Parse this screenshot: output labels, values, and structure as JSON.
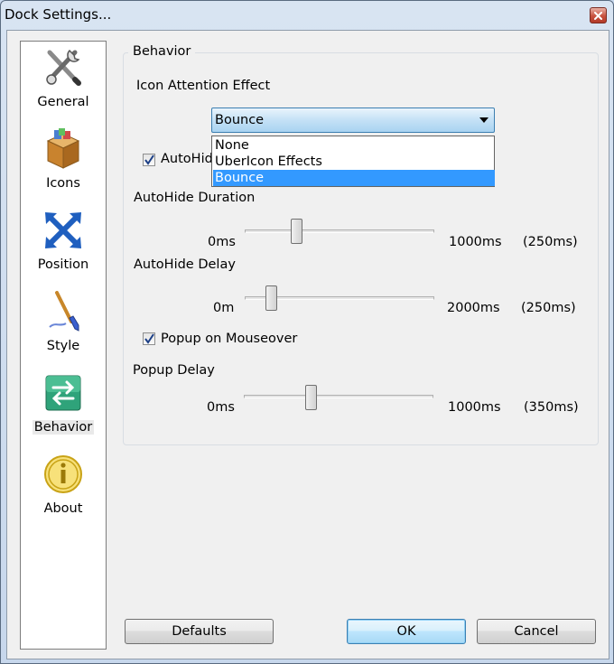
{
  "window": {
    "title": "Dock Settings..."
  },
  "sidebar": {
    "items": [
      {
        "label": "General",
        "icon": "tools-icon"
      },
      {
        "label": "Icons",
        "icon": "box-icon"
      },
      {
        "label": "Position",
        "icon": "arrows-icon"
      },
      {
        "label": "Style",
        "icon": "brush-icon"
      },
      {
        "label": "Behavior",
        "icon": "behavior-icon",
        "selected": true
      },
      {
        "label": "About",
        "icon": "info-icon"
      }
    ]
  },
  "behavior": {
    "group_title": "Behavior",
    "icon_attention": {
      "label": "Icon Attention Effect",
      "selected": "Bounce",
      "options": [
        "None",
        "UberIcon Effects",
        "Bounce"
      ]
    },
    "autohide": {
      "label_visible": "AutoHid",
      "checked": true
    },
    "autohide_duration": {
      "label": "AutoHide Duration",
      "min": "0ms",
      "max": "1000ms",
      "current": "(250ms)",
      "value_fraction": 0.27
    },
    "autohide_delay": {
      "label": "AutoHide Delay",
      "min": "0m",
      "max": "2000ms",
      "current": "(250ms)",
      "value_fraction": 0.14
    },
    "popup_on_mouseover": {
      "label": "Popup on Mouseover",
      "checked": true
    },
    "popup_delay": {
      "label": "Popup Delay",
      "min": "0ms",
      "max": "1000ms",
      "current": "(350ms)",
      "value_fraction": 0.35
    }
  },
  "buttons": {
    "defaults": "Defaults",
    "ok": "OK",
    "cancel": "Cancel"
  },
  "colors": {
    "selection": "#3399ff",
    "default_button": "#3c7fb1"
  }
}
